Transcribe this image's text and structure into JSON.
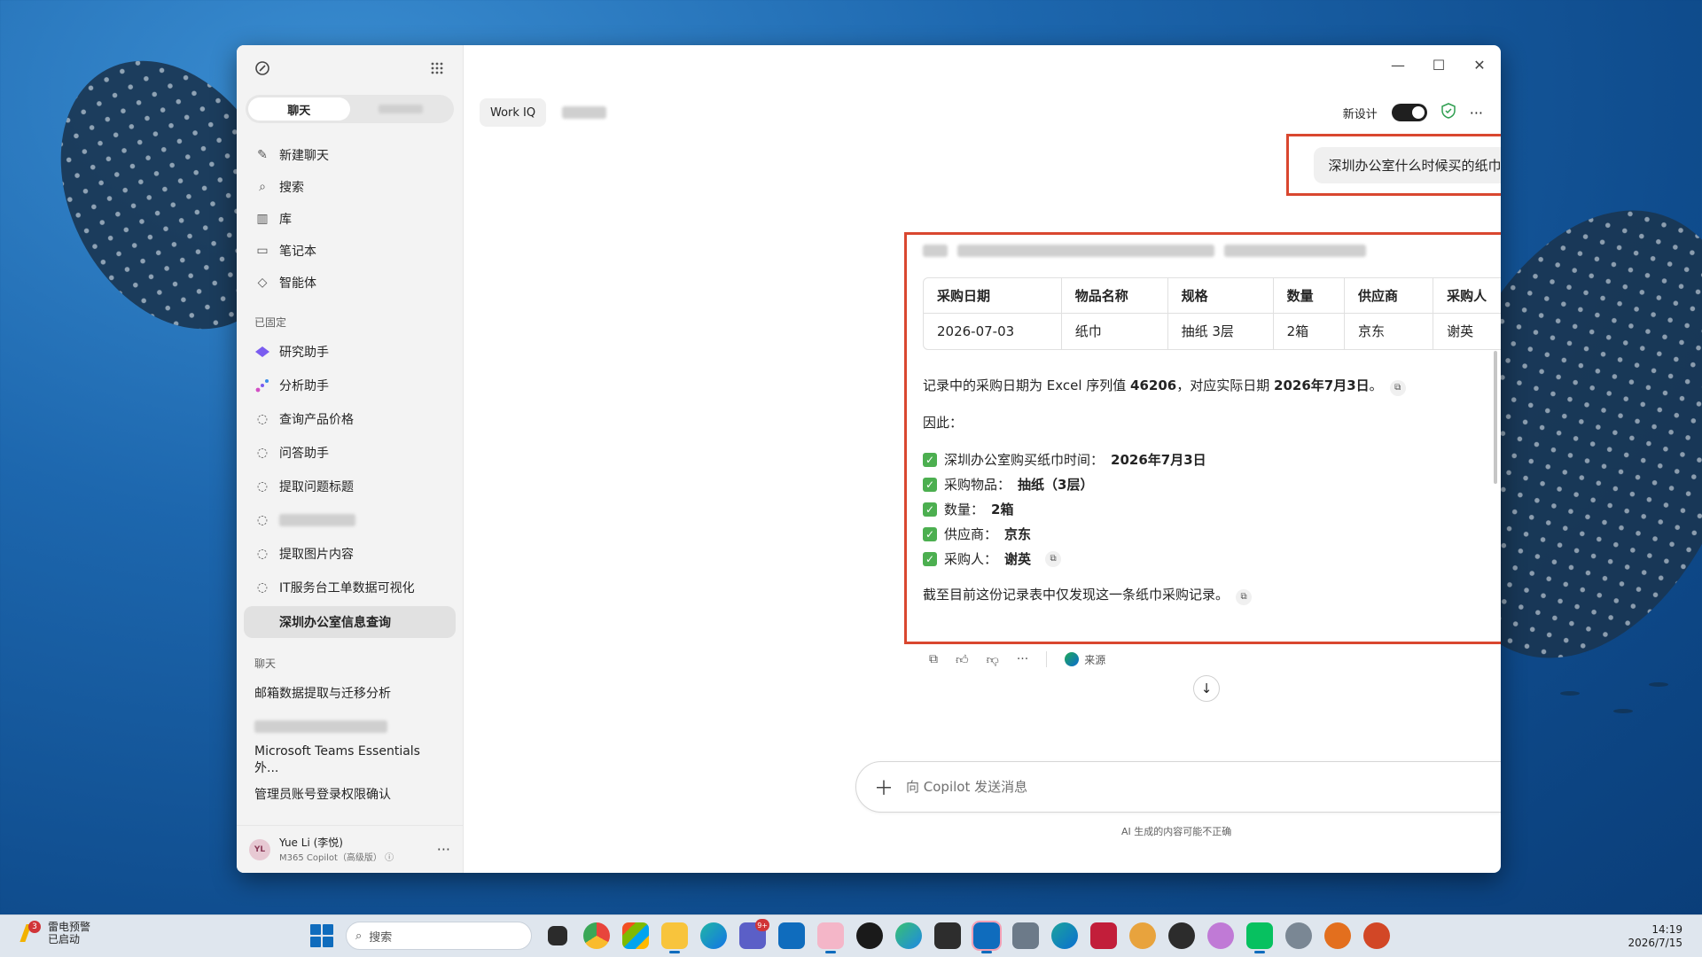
{
  "colors": {
    "accent_red": "#d9472f",
    "check_green": "#4caf50",
    "taskbar_accent": "#0f6cbd"
  },
  "sidebar": {
    "tabs": {
      "chat": "聊天"
    },
    "menu": [
      {
        "label": "新建聊天",
        "icon": "compose-icon"
      },
      {
        "label": "搜索",
        "icon": "search-icon"
      },
      {
        "label": "库",
        "icon": "library-icon"
      },
      {
        "label": "笔记本",
        "icon": "folder-icon"
      },
      {
        "label": "智能体",
        "icon": "agents-icon"
      }
    ],
    "pinned_title": "已固定",
    "pinned": [
      "研究助手",
      "分析助手",
      "查询产品价格",
      "问答助手",
      "提取问题标题",
      "",
      "提取图片内容",
      "IT服务台工单数据可视化",
      "深圳办公室信息查询"
    ],
    "chats_title": "聊天",
    "chats": [
      "邮箱数据提取与迁移分析",
      "",
      "Microsoft Teams Essentials 外...",
      "管理员账号登录权限确认"
    ],
    "user": {
      "initials": "YL",
      "name": "Yue Li (李悦)",
      "plan": "M365 Copilot（高级版）"
    }
  },
  "topbar": {
    "chip": "Work IQ",
    "new_design_label": "新设计"
  },
  "user_message": "深圳办公室什么时候买的纸巾",
  "answer": {
    "table": {
      "headers": [
        "采购日期",
        "物品名称",
        "规格",
        "数量",
        "供应商",
        "采购人"
      ],
      "rows": [
        [
          "2026-07-03",
          "纸巾",
          "抽纸 3层",
          "2箱",
          "京东",
          "谢英"
        ]
      ]
    },
    "p1_prefix": "记录中的采购日期为 Excel 序列值 ",
    "p1_serial": "46206",
    "p1_mid": "，对应实际日期 ",
    "p1_date": "2026年7月3日",
    "p1_end": "。",
    "p2": "因此：",
    "bullets": [
      {
        "label": "深圳办公室购买纸巾时间：",
        "value": "2026年7月3日"
      },
      {
        "label": "采购物品：",
        "value": "抽纸（3层）"
      },
      {
        "label": "数量：",
        "value": "2箱"
      },
      {
        "label": "供应商：",
        "value": "京东"
      },
      {
        "label": "采购人：",
        "value": "谢英"
      }
    ],
    "footer": "截至目前这份记录表中仅发现这一条纸巾采购记录。"
  },
  "actions": {
    "source_label": "来源"
  },
  "composer": {
    "placeholder": "向 Copilot 发送消息"
  },
  "disclaimer": "AI 生成的内容可能不正确",
  "taskbar": {
    "weather_title": "雷电预警",
    "weather_sub": "已启动",
    "weather_badge": "3",
    "search_label": "搜索",
    "teams_badge": "9+",
    "time": "14:19",
    "date": "2026/7/15"
  }
}
